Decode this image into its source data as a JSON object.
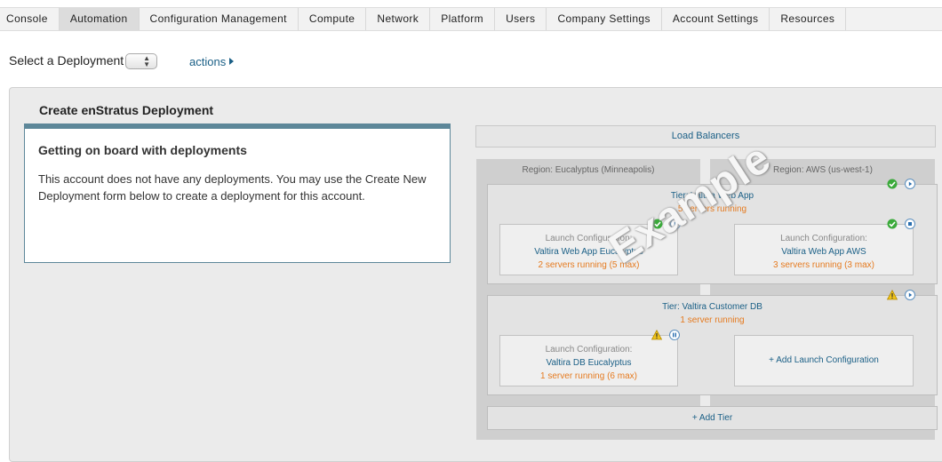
{
  "nav": {
    "tabs": [
      "Console",
      "Automation",
      "Configuration Management",
      "Compute",
      "Network",
      "Platform",
      "Users",
      "Company Settings",
      "Account Settings",
      "Resources"
    ],
    "active": "Automation"
  },
  "selector": {
    "label": "Select a Deployment",
    "actions_label": "actions"
  },
  "panel": {
    "title": "Create enStratus Deployment"
  },
  "info": {
    "title": "Getting on board with deployments",
    "body": "This account does not have any deployments. You may use the Create New Deployment form below to create a deployment for this account."
  },
  "builder": {
    "load_balancers": "Load Balancers",
    "regions": [
      "Region: Eucalyptus (Minneapolis)",
      "Region: AWS (us-west-1)"
    ],
    "tier1": {
      "title": "Tier: Valtira Web App",
      "status": "5 servers running",
      "lc_left": {
        "label": "Launch Configuration:",
        "name": "Valtira Web App Eucalyptus",
        "status": "2 servers running (5 max)"
      },
      "lc_right": {
        "label": "Launch Configuration:",
        "name": "Valtira Web App AWS",
        "status": "3 servers running (3 max)"
      }
    },
    "tier2": {
      "title": "Tier: Valtira Customer DB",
      "status": "1 server running",
      "lc_left": {
        "label": "Launch Configuration:",
        "name": "Valtira DB Eucalyptus",
        "status": "1 server running (6 max)"
      },
      "add_lc": "+ Add Launch Configuration"
    },
    "add_tier": "+ Add Tier",
    "watermark": "Example"
  },
  "colors": {
    "link": "#1a5f86",
    "status_orange": "#e57a1f",
    "ok_green": "#3aaa3a",
    "warn_yellow": "#f0c419",
    "info_border": "#5d8799"
  },
  "icons": [
    "check-circle-icon",
    "play-circle-icon",
    "stop-circle-icon",
    "pause-circle-icon",
    "warning-triangle-icon"
  ]
}
